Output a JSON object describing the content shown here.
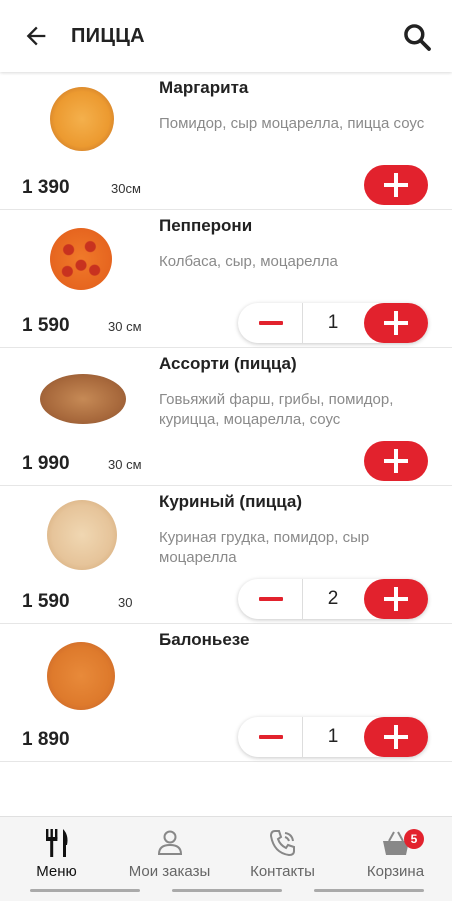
{
  "header": {
    "title": "ПИЦЦА",
    "back_icon": "arrow-left-icon",
    "search_icon": "search-icon"
  },
  "items": [
    {
      "name": "Маргарита",
      "desc": "Помидор, сыр моцарелла, пицца соус",
      "price": "1 390",
      "size": "30см",
      "qty": null
    },
    {
      "name": "Пепперони",
      "desc": "Колбаса, сыр, моцарелла",
      "price": "1 590",
      "size": "30 см",
      "qty": "1"
    },
    {
      "name": "Ассорти (пицца)",
      "desc": "Говьяжий фарш, грибы, помидор, курицца, моцарелла, соус",
      "price": "1 990",
      "size": "30 см",
      "qty": null
    },
    {
      "name": "Куриный (пицца)",
      "desc": "Куриная грудка, помидор, сыр моцарелла",
      "price": "1 590",
      "size": "30",
      "qty": "2"
    },
    {
      "name": "Балоньезе",
      "desc": "",
      "price": "1 890",
      "size": "",
      "qty": "1"
    }
  ],
  "nav": [
    {
      "label": "Меню",
      "icon": "cutlery-icon",
      "active": true
    },
    {
      "label": "Мои заказы",
      "icon": "user-icon",
      "active": false
    },
    {
      "label": "Контакты",
      "icon": "phone-icon",
      "active": false
    },
    {
      "label": "Корзина",
      "icon": "basket-icon",
      "active": false,
      "badge": "5"
    }
  ],
  "colors": {
    "accent": "#e2222d"
  }
}
